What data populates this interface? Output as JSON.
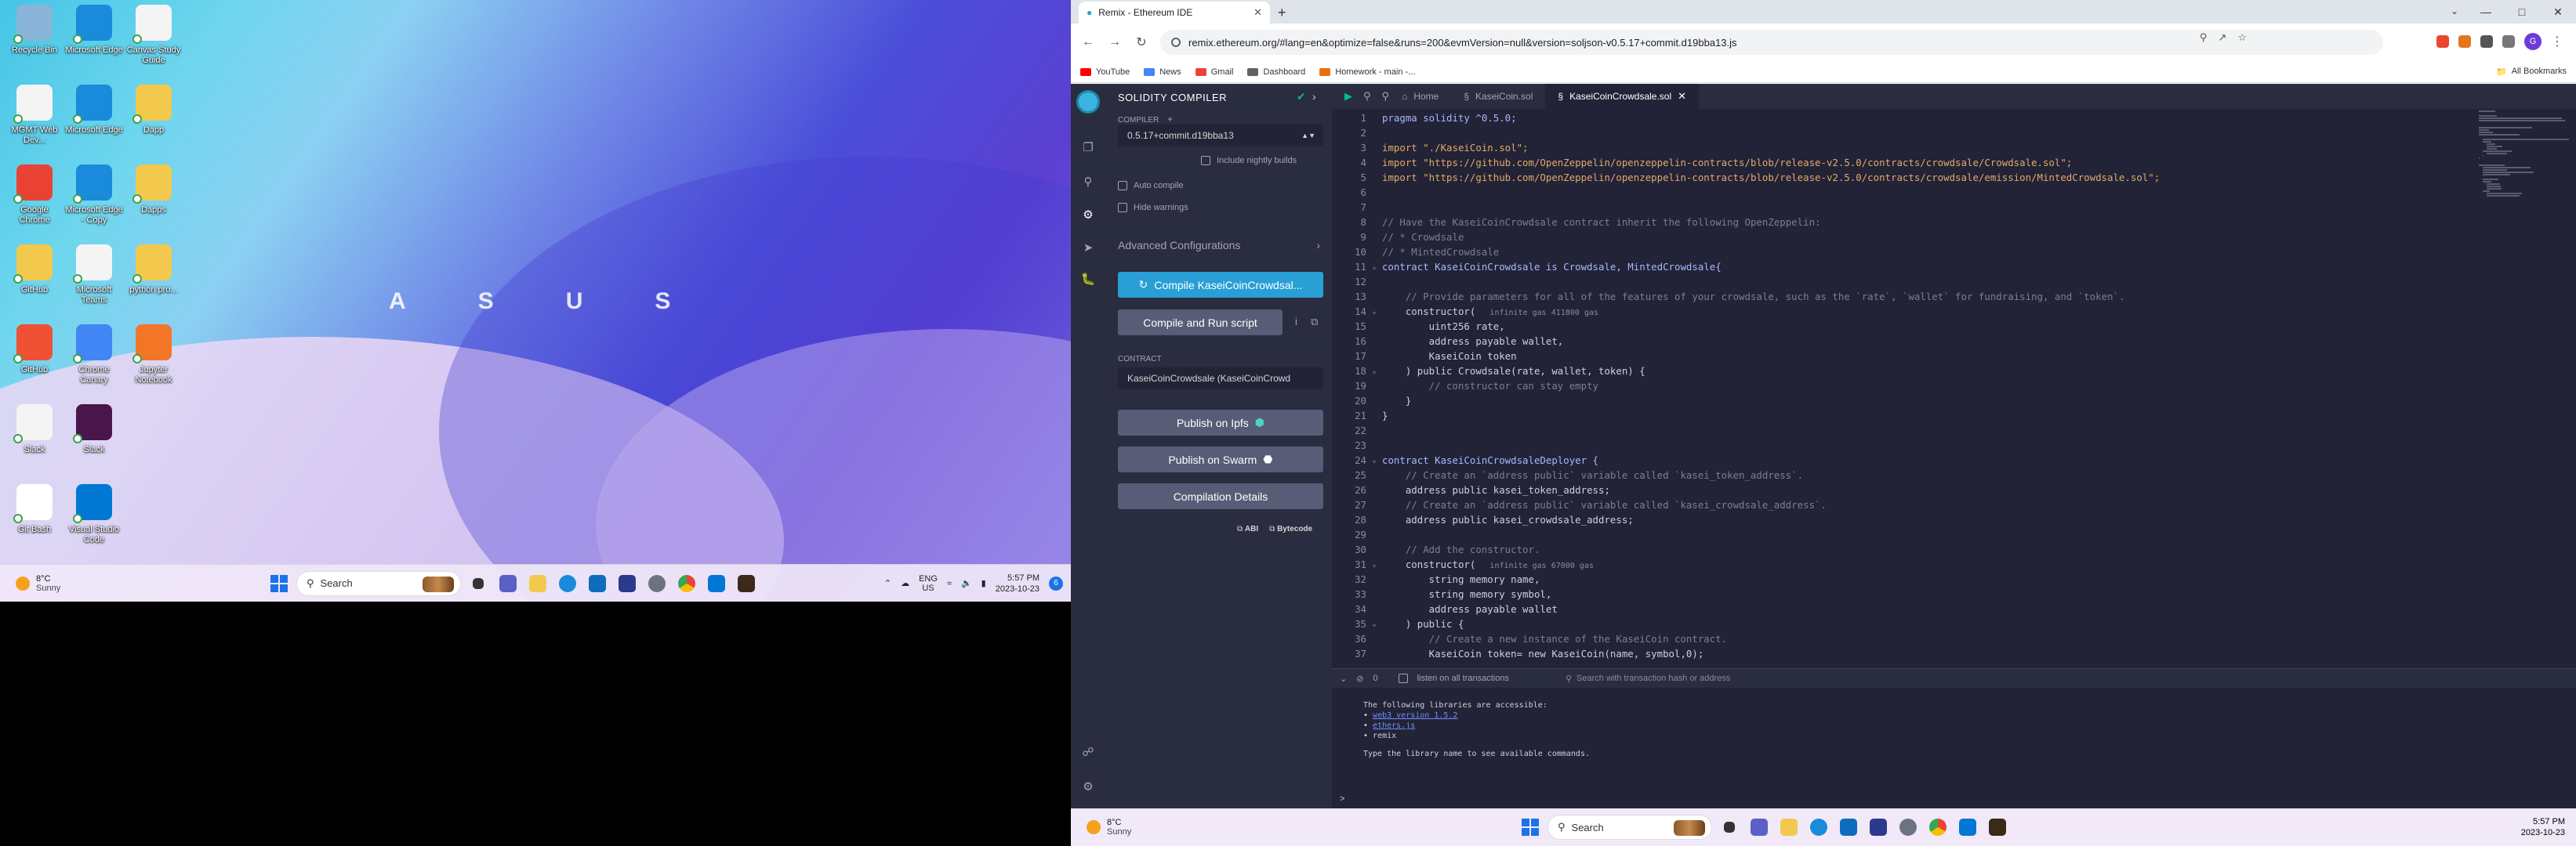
{
  "left_desktop": {
    "brand_letters": [
      "A",
      "S",
      "U",
      "S"
    ],
    "icons": [
      {
        "label": "Recycle Bin",
        "color": "#8ab4d8",
        "icon": "recycle-bin-icon"
      },
      {
        "label": "Microsoft Edge",
        "color": "#1a8adb",
        "icon": "edge-icon"
      },
      {
        "label": "Canvas Study Guide",
        "color": "#f4f4f4",
        "icon": "document-icon"
      },
      {
        "label": "MGMT Web Dev...",
        "color": "#f4f4f4",
        "icon": "document-icon"
      },
      {
        "label": "Microsoft Edge",
        "color": "#1a8adb",
        "icon": "edge-icon"
      },
      {
        "label": "Dapp",
        "color": "#f2c94c",
        "icon": "folder-icon"
      },
      {
        "label": "Google Chrome",
        "color": "#e94235",
        "icon": "chrome-icon"
      },
      {
        "label": "Microsoft Edge - Copy",
        "color": "#1a8adb",
        "icon": "edge-icon"
      },
      {
        "label": "Dapps",
        "color": "#f2c94c",
        "icon": "folder-icon"
      },
      {
        "label": "GitHub",
        "color": "#f2c94c",
        "icon": "folder-icon"
      },
      {
        "label": "Microsoft Teams",
        "color": "#f4f4f4",
        "icon": "document-icon"
      },
      {
        "label": "python pro...",
        "color": "#f2c94c",
        "icon": "folder-icon"
      },
      {
        "label": "GitHub",
        "color": "#f05033",
        "icon": "git-icon"
      },
      {
        "label": "Chrome Canary",
        "color": "#4285f4",
        "icon": "chrome-icon"
      },
      {
        "label": "Jupyter Notebook",
        "color": "#f37626",
        "icon": "app-icon"
      },
      {
        "label": "Slack",
        "color": "#f4f4f4",
        "icon": "document-icon"
      },
      {
        "label": "Slack",
        "color": "#4a154b",
        "icon": "slack-icon"
      },
      {
        "label": "",
        "color": "transparent",
        "icon": ""
      },
      {
        "label": "Git Bash",
        "color": "#ffffff",
        "icon": "git-icon"
      },
      {
        "label": "Visual Studio Code",
        "color": "#0078d4",
        "icon": "vscode-icon"
      }
    ],
    "taskbar": {
      "temp": "8°C",
      "weather": "Sunny",
      "search_label": "Search",
      "lang_line1": "ENG",
      "lang_line2": "US",
      "time": "5:57 PM",
      "date": "2023-10-23",
      "notif_count": "6"
    }
  },
  "browser": {
    "tab_title": "Remix - Ethereum IDE",
    "url": "remix.ethereum.org/#lang=en&optimize=false&runs=200&evmVersion=null&version=soljson-v0.5.17+commit.d19bba13.js",
    "profile_letter": "G",
    "bookmarks": [
      {
        "label": "YouTube",
        "color": "#ff0000"
      },
      {
        "label": "News",
        "color": "#4285f4"
      },
      {
        "label": "Gmail",
        "color": "#ea4335"
      },
      {
        "label": "Dashboard",
        "color": "#5f6368"
      },
      {
        "label": "Homework - main -...",
        "color": "#e8710a"
      }
    ],
    "all_bookmarks": "All Bookmarks"
  },
  "remix": {
    "sidepanel": {
      "title": "SOLIDITY COMPILER",
      "compiler_label": "COMPILER",
      "compiler_version": "0.5.17+commit.d19bba13",
      "include_nightly": "Include nightly builds",
      "auto_compile": "Auto compile",
      "hide_warnings": "Hide warnings",
      "advanced": "Advanced Configurations",
      "compile_button": "Compile KaseiCoinCrowdsal...",
      "compile_run": "Compile and Run script",
      "contract_label": "CONTRACT",
      "contract_value": "KaseiCoinCrowdsale (KaseiCoinCrowd",
      "publish_ipfs": "Publish on Ipfs",
      "publish_swarm": "Publish on Swarm",
      "compilation_details": "Compilation Details",
      "abi": "ABI",
      "bytecode": "Bytecode"
    },
    "tabs": [
      {
        "label": "Home",
        "active": false
      },
      {
        "label": "KaseiCoin.sol",
        "active": false
      },
      {
        "label": "KaseiCoinCrowdsale.sol",
        "active": true
      }
    ],
    "code_lines": [
      {
        "n": "1",
        "fold": "",
        "text": "pragma solidity ^0.5.0;",
        "gas": ""
      },
      {
        "n": "2",
        "fold": "",
        "text": "",
        "gas": ""
      },
      {
        "n": "3",
        "fold": "",
        "text": "import \"./KaseiCoin.sol\";",
        "gas": ""
      },
      {
        "n": "4",
        "fold": "",
        "text": "import \"https://github.com/OpenZeppelin/openzeppelin-contracts/blob/release-v2.5.0/contracts/crowdsale/Crowdsale.sol\";",
        "gas": ""
      },
      {
        "n": "5",
        "fold": "",
        "text": "import \"https://github.com/OpenZeppelin/openzeppelin-contracts/blob/release-v2.5.0/contracts/crowdsale/emission/MintedCrowdsale.sol\";",
        "gas": ""
      },
      {
        "n": "6",
        "fold": "",
        "text": "",
        "gas": ""
      },
      {
        "n": "7",
        "fold": "",
        "text": "",
        "gas": ""
      },
      {
        "n": "8",
        "fold": "",
        "text": "// Have the KaseiCoinCrowdsale contract inherit the following OpenZeppelin:",
        "gas": ""
      },
      {
        "n": "9",
        "fold": "",
        "text": "// * Crowdsale",
        "gas": ""
      },
      {
        "n": "10",
        "fold": "",
        "text": "// * MintedCrowdsale",
        "gas": ""
      },
      {
        "n": "11",
        "fold": "v",
        "text": "contract KaseiCoinCrowdsale is Crowdsale, MintedCrowdsale{",
        "gas": ""
      },
      {
        "n": "12",
        "fold": "",
        "text": "",
        "gas": ""
      },
      {
        "n": "13",
        "fold": "",
        "text": "    // Provide parameters for all of the features of your crowdsale, such as the `rate`, `wallet` for fundraising, and `token`.",
        "gas": ""
      },
      {
        "n": "14",
        "fold": "v",
        "text": "    constructor(",
        "gas": "   infinite gas 411800 gas"
      },
      {
        "n": "15",
        "fold": "",
        "text": "        uint256 rate,",
        "gas": ""
      },
      {
        "n": "16",
        "fold": "",
        "text": "        address payable wallet,",
        "gas": ""
      },
      {
        "n": "17",
        "fold": "",
        "text": "        KaseiCoin token",
        "gas": ""
      },
      {
        "n": "18",
        "fold": "v",
        "text": "    ) public Crowdsale(rate, wallet, token) {",
        "gas": ""
      },
      {
        "n": "19",
        "fold": "",
        "text": "        // constructor can stay empty",
        "gas": ""
      },
      {
        "n": "20",
        "fold": "",
        "text": "    }",
        "gas": ""
      },
      {
        "n": "21",
        "fold": "",
        "text": "}",
        "gas": ""
      },
      {
        "n": "22",
        "fold": "",
        "text": "",
        "gas": ""
      },
      {
        "n": "23",
        "fold": "",
        "text": "",
        "gas": ""
      },
      {
        "n": "24",
        "fold": "v",
        "text": "contract KaseiCoinCrowdsaleDeployer {",
        "gas": ""
      },
      {
        "n": "25",
        "fold": "",
        "text": "    // Create an `address public` variable called `kasei_token_address`.",
        "gas": ""
      },
      {
        "n": "26",
        "fold": "",
        "text": "    address public kasei_token_address;",
        "gas": ""
      },
      {
        "n": "27",
        "fold": "",
        "text": "    // Create an `address public` variable called `kasei_crowdsale_address`.",
        "gas": ""
      },
      {
        "n": "28",
        "fold": "",
        "text": "    address public kasei_crowdsale_address;",
        "gas": ""
      },
      {
        "n": "29",
        "fold": "",
        "text": "",
        "gas": ""
      },
      {
        "n": "30",
        "fold": "",
        "text": "    // Add the constructor.",
        "gas": ""
      },
      {
        "n": "31",
        "fold": "v",
        "text": "    constructor(",
        "gas": "   infinite gas 67000 gas"
      },
      {
        "n": "32",
        "fold": "",
        "text": "        string memory name,",
        "gas": ""
      },
      {
        "n": "33",
        "fold": "",
        "text": "        string memory symbol,",
        "gas": ""
      },
      {
        "n": "34",
        "fold": "",
        "text": "        address payable wallet",
        "gas": ""
      },
      {
        "n": "35",
        "fold": "v",
        "text": "    ) public {",
        "gas": ""
      },
      {
        "n": "36",
        "fold": "",
        "text": "        // Create a new instance of the KaseiCoin contract.",
        "gas": ""
      },
      {
        "n": "37",
        "fold": "",
        "text": "        KaseiCoin token= new KaseiCoin(name, symbol,0);",
        "gas": ""
      }
    ],
    "terminal": {
      "count": "0",
      "listen_label": "listen on all transactions",
      "search_placeholder": "Search with transaction hash or address",
      "intro": "The following libraries are accessible:",
      "libs": [
        "web3 version 1.5.2",
        "ethers.js",
        "remix"
      ],
      "hint": "Type the library name to see available commands.",
      "prompt": ">"
    }
  },
  "right_taskbar": {
    "temp": "8°C",
    "weather": "Sunny",
    "search_label": "Search",
    "time": "5:57 PM",
    "date": "2023-10-23"
  }
}
